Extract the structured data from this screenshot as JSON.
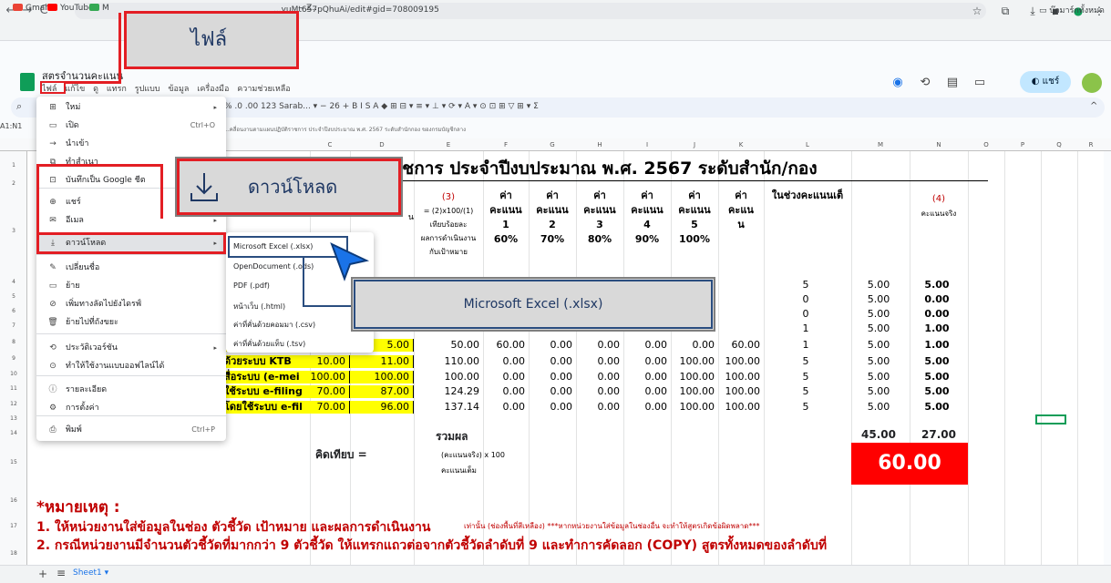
{
  "browser": {
    "url": "...yuMt657pQhuAi/edit#gid=708009195",
    "bookmarks": [
      "Gmail",
      "YouTube",
      "M",
      "- Z.."
    ],
    "bookmark_folder": "บุ๊กมาร์กทั้งหมด"
  },
  "sheets": {
    "doc_title": "สตรจำนวนคะแนน",
    "menus": [
      "ไฟล์",
      "แก้ไข",
      "ดู",
      "แทรก",
      "รูปแบบ",
      "ข้อมูล",
      "เครื่องมือ",
      "ความช่วยเหลือ"
    ],
    "share_label": "แชร์",
    "toolbar_text": "% .0 .00 123 Sarab... ▾  −  26  +  B  I  S  A  ◆  ⊞  ⊟ ▾  ≡ ▾  ⊥ ▾  ⟳ ▾  A ▾  ⊙  ⊡  ⊞  ▽  ⊞ ▾  Σ",
    "namebox": "A1:N1",
    "formula_text": "...คลื่อนงานตามแผนปฏิบัติราชการ ประจำปีงบประมาณ พ.ศ. 2567 ระดับสำนักกอง ของกรมบัญชีกลาง",
    "columns": [
      "C",
      "D",
      "E",
      "F",
      "G",
      "H",
      "I",
      "J",
      "K",
      "L",
      "M",
      "N",
      "O",
      "P",
      "Q",
      "R"
    ],
    "rows": [
      "1",
      "2",
      "3",
      "4",
      "5",
      "6",
      "7",
      "8",
      "9",
      "10",
      "11",
      "12",
      "13",
      "14",
      "15",
      "16",
      "17",
      "18"
    ],
    "sheet_tab": "Sheet1"
  },
  "table": {
    "title": "...ามแผนปฏิบัติราชการ ประจำปีงบประมาณ พ.ศ. 2567 ระดับสำนัก/กอง",
    "header_3": "(3)",
    "header_3_formula": "= (2)x100/(1)",
    "header_3_sub": [
      "เทียบร้อยละ",
      "ผลการดำเนินงาน",
      "กับเป้าหมาย"
    ],
    "header_left_cut": "น",
    "score_heads": [
      {
        "top": "ค่า",
        "mid": "คะแนน",
        "num": "1",
        "pct": "60%"
      },
      {
        "top": "ค่า",
        "mid": "คะแนน",
        "num": "2",
        "pct": "70%"
      },
      {
        "top": "ค่า",
        "mid": "คะแนน",
        "num": "3",
        "pct": "80%"
      },
      {
        "top": "ค่า",
        "mid": "คะแนน",
        "num": "4",
        "pct": "90%"
      },
      {
        "top": "ค่า",
        "mid": "คะแนน",
        "num": "5",
        "pct": "100%"
      },
      {
        "top": "ค่า",
        "mid": "คะแน",
        "num": "น",
        "pct": ""
      }
    ],
    "range_head": "ในช่วงคะแนนเต็",
    "header_4": "(4)",
    "header_4_sub": "คะแนนจริง",
    "rows": [
      {
        "l": "5",
        "m": "5.00",
        "n": "5.00"
      },
      {
        "l": "0",
        "m": "5.00",
        "n": "0.00"
      },
      {
        "l": "0",
        "m": "5.00",
        "n": "0.00"
      },
      {
        "l": "1",
        "m": "5.00",
        "n": "1.00"
      },
      {
        "name": "",
        "c": "",
        "d": "5.00",
        "e": "50.00",
        "f": "60.00",
        "g": "0.00",
        "h": "0.00",
        "i": "0.00",
        "j": "0.00",
        "k": "60.00",
        "l": "1",
        "m": "5.00",
        "n": "1.00"
      },
      {
        "name": "ด้วยระบบ KTB",
        "c": "10.00",
        "d": "11.00",
        "e": "110.00",
        "f": "0.00",
        "g": "0.00",
        "h": "0.00",
        "i": "0.00",
        "j": "100.00",
        "k": "100.00",
        "l": "5",
        "m": "5.00",
        "n": "5.00"
      },
      {
        "name": "สื่อระบบ (e-mei",
        "c": "100.00",
        "d": "100.00",
        "e": "100.00",
        "f": "0.00",
        "g": "0.00",
        "h": "0.00",
        "i": "0.00",
        "j": "100.00",
        "k": "100.00",
        "l": "5",
        "m": "5.00",
        "n": "5.00"
      },
      {
        "name": "ใช้ระบบ e-filing",
        "c": "70.00",
        "d": "87.00",
        "e": "124.29",
        "f": "0.00",
        "g": "0.00",
        "h": "0.00",
        "i": "0.00",
        "j": "100.00",
        "k": "100.00",
        "l": "5",
        "m": "5.00",
        "n": "5.00"
      },
      {
        "name": "โดยใช้ระบบ e-fil",
        "c": "70.00",
        "d": "96.00",
        "e": "137.14",
        "f": "0.00",
        "g": "0.00",
        "h": "0.00",
        "i": "0.00",
        "j": "100.00",
        "k": "100.00",
        "l": "5",
        "m": "5.00",
        "n": "5.00"
      }
    ],
    "total_label": "รวมผล",
    "total_full": "45.00",
    "total_actual": "27.00",
    "formula_label": "คิดเทียบ = ",
    "formula_num": "(คะแนนจริง) x 100",
    "formula_den": "คะแนนเต็ม",
    "score": "60.00",
    "note_title": "*หมายเหตุ :",
    "note_1": "1. ให้หน่วยงานใส่ข้อมูลในช่อง ตัวชี้วัด เป้าหมาย และผลการดำเนินงาน",
    "note_1b": "เท่านั้น (ช่องพื้นที่สีเหลือง) ***หากหน่วยงานใส่ข้อมูลในช่องอื่น จะทำให้สูตรเกิดข้อผิดพลาด***",
    "note_2": "2. กรณีหน่วยงานมีจำนวนตัวชี้วัดที่มากกว่า 9 ตัวชี้วัด ให้แทรกแถวต่อจากตัวชี้วัดลำดับที่ 9 และทำการคัดลอก (COPY) สูตรทั้งหมดของลำดับที่"
  },
  "file_menu": {
    "items": [
      {
        "icon": "⊞",
        "label": "ใหม่",
        "shortcut": "",
        "arrow": "▸"
      },
      {
        "icon": "▭",
        "label": "เปิด",
        "shortcut": "Ctrl+O",
        "arrow": ""
      },
      {
        "icon": "→",
        "label": "นำเข้า",
        "shortcut": "",
        "arrow": ""
      },
      {
        "icon": "⧉",
        "label": "ทำสำเนา",
        "shortcut": "",
        "arrow": ""
      },
      {
        "icon": "⊡",
        "label": "บันทึกเป็น Google ชีต",
        "shortcut": "",
        "arrow": ""
      },
      {
        "icon": "⊕",
        "label": "แชร์",
        "shortcut": "",
        "arrow": "▸"
      },
      {
        "icon": "✉",
        "label": "อีเมล",
        "shortcut": "",
        "arrow": "▸"
      },
      {
        "icon": "⤓",
        "label": "ดาวน์โหลด",
        "shortcut": "",
        "arrow": "▸"
      },
      {
        "icon": "✎",
        "label": "เปลี่ยนชื่อ",
        "shortcut": "",
        "arrow": ""
      },
      {
        "icon": "▭",
        "label": "ย้าย",
        "shortcut": "",
        "arrow": ""
      },
      {
        "icon": "⊘",
        "label": "เพิ่มทางลัดไปยังไดรฟ์",
        "shortcut": "",
        "arrow": ""
      },
      {
        "icon": "🗑",
        "label": "ย้ายไปที่ถังขยะ",
        "shortcut": "",
        "arrow": ""
      },
      {
        "icon": "⟲",
        "label": "ประวัติเวอร์ชัน",
        "shortcut": "",
        "arrow": "▸"
      },
      {
        "icon": "⊙",
        "label": "ทำให้ใช้งานแบบออฟไลน์ได้",
        "shortcut": "",
        "arrow": ""
      },
      {
        "icon": "ⓘ",
        "label": "รายละเอียด",
        "shortcut": "",
        "arrow": ""
      },
      {
        "icon": "⚙",
        "label": "การตั้งค่า",
        "shortcut": "",
        "arrow": ""
      },
      {
        "icon": "⎙",
        "label": "พิมพ์",
        "shortcut": "Ctrl+P",
        "arrow": ""
      }
    ]
  },
  "download_submenu": [
    "Microsoft Excel (.xlsx)",
    "OpenDocument (.ods)",
    "PDF (.pdf)",
    "หน้าเว็บ (.html)",
    "ค่าที่คั่นด้วยคอมมา (.csv)",
    "ค่าที่คั่นด้วยแท็บ (.tsv)"
  ],
  "callouts": {
    "file": "ไฟล์",
    "download": "ดาวน์โหลด",
    "xlsx": "Microsoft Excel (.xlsx)"
  }
}
